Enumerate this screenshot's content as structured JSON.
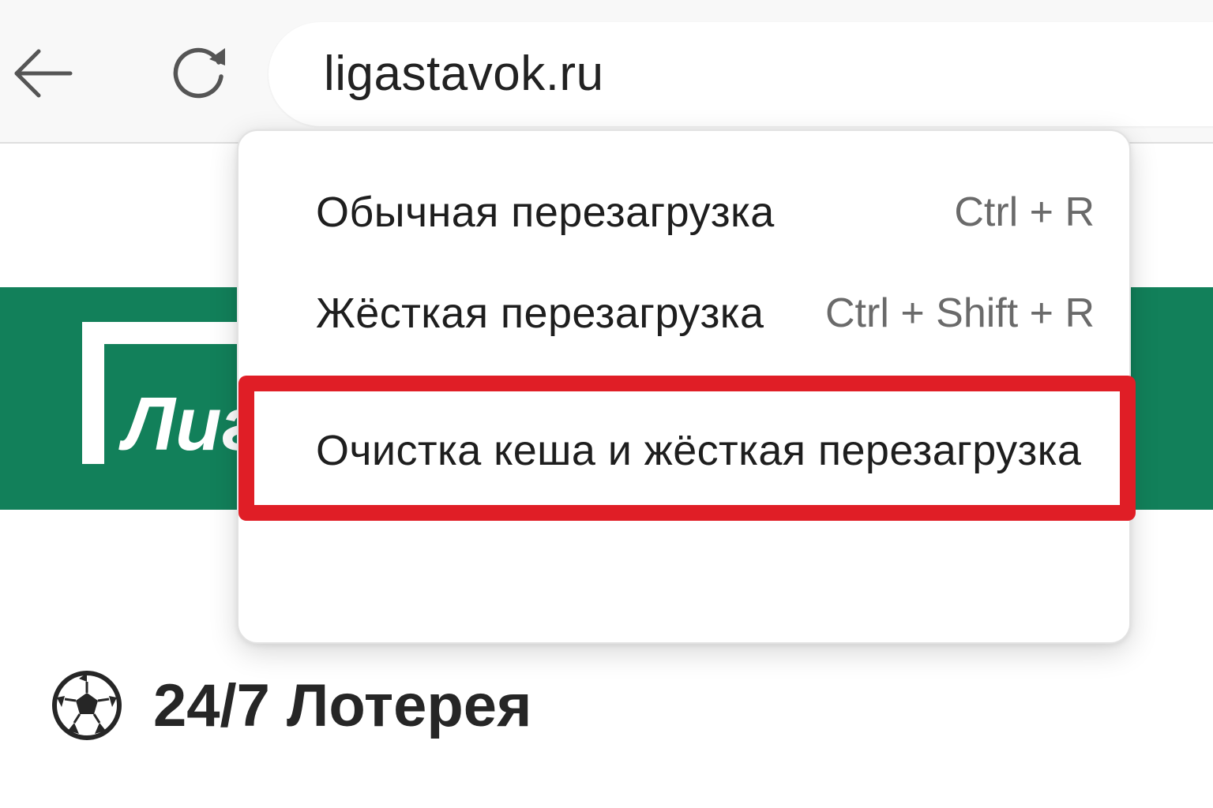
{
  "browser": {
    "url": "ligastavok.ru",
    "icons": {
      "back": "arrow-left-icon",
      "reload": "reload-icon"
    }
  },
  "page": {
    "logo_text": "Лиг",
    "lottery": {
      "icon": "soccer-ball-icon",
      "label": "24/7 Лотерея"
    },
    "colors": {
      "banner": "#12805a",
      "highlight": "#e01e26"
    }
  },
  "context_menu": {
    "items": [
      {
        "label": "Обычная перезагрузка",
        "shortcut": "Ctrl + R"
      },
      {
        "label": "Жёсткая перезагрузка",
        "shortcut": "Ctrl + Shift + R"
      },
      {
        "label": "Очистка кеша и жёсткая перезагрузка",
        "shortcut": ""
      }
    ],
    "highlighted_item": "Очистка кеша и жёсткая перезагрузка"
  }
}
